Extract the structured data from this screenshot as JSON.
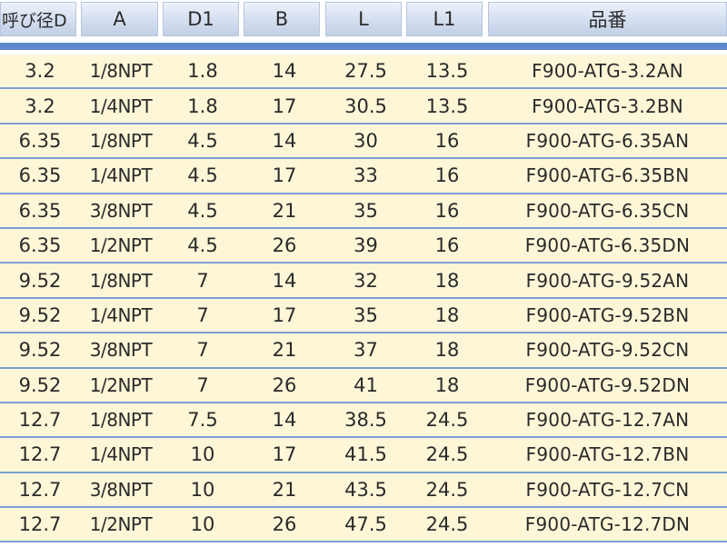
{
  "table": {
    "headers": [
      "呼び径D",
      "A",
      "D1",
      "B",
      "L",
      "L1",
      "品番"
    ],
    "rows": [
      [
        "3.2",
        "1/8NPT",
        "1.8",
        "14",
        "27.5",
        "13.5",
        "F900-ATG-3.2AN"
      ],
      [
        "3.2",
        "1/4NPT",
        "1.8",
        "17",
        "30.5",
        "13.5",
        "F900-ATG-3.2BN"
      ],
      [
        "6.35",
        "1/8NPT",
        "4.5",
        "14",
        "30",
        "16",
        "F900-ATG-6.35AN"
      ],
      [
        "6.35",
        "1/4NPT",
        "4.5",
        "17",
        "33",
        "16",
        "F900-ATG-6.35BN"
      ],
      [
        "6.35",
        "3/8NPT",
        "4.5",
        "21",
        "35",
        "16",
        "F900-ATG-6.35CN"
      ],
      [
        "6.35",
        "1/2NPT",
        "4.5",
        "26",
        "39",
        "16",
        "F900-ATG-6.35DN"
      ],
      [
        "9.52",
        "1/8NPT",
        "7",
        "14",
        "32",
        "18",
        "F900-ATG-9.52AN"
      ],
      [
        "9.52",
        "1/4NPT",
        "7",
        "17",
        "35",
        "18",
        "F900-ATG-9.52BN"
      ],
      [
        "9.52",
        "3/8NPT",
        "7",
        "21",
        "37",
        "18",
        "F900-ATG-9.52CN"
      ],
      [
        "9.52",
        "1/2NPT",
        "7",
        "26",
        "41",
        "18",
        "F900-ATG-9.52DN"
      ],
      [
        "12.7",
        "1/8NPT",
        "7.5",
        "14",
        "38.5",
        "24.5",
        "F900-ATG-12.7AN"
      ],
      [
        "12.7",
        "1/4NPT",
        "10",
        "17",
        "41.5",
        "24.5",
        "F900-ATG-12.7BN"
      ],
      [
        "12.7",
        "3/8NPT",
        "10",
        "21",
        "43.5",
        "24.5",
        "F900-ATG-12.7CN"
      ],
      [
        "12.7",
        "1/2NPT",
        "10",
        "26",
        "47.5",
        "24.5",
        "F900-ATG-12.7DN"
      ]
    ]
  },
  "colors": {
    "header_gradient": "#c1cfe6",
    "accent_bar": "#5f88cf",
    "row_background": "#fdf7d8",
    "row_divider": "#7e9ed6"
  }
}
